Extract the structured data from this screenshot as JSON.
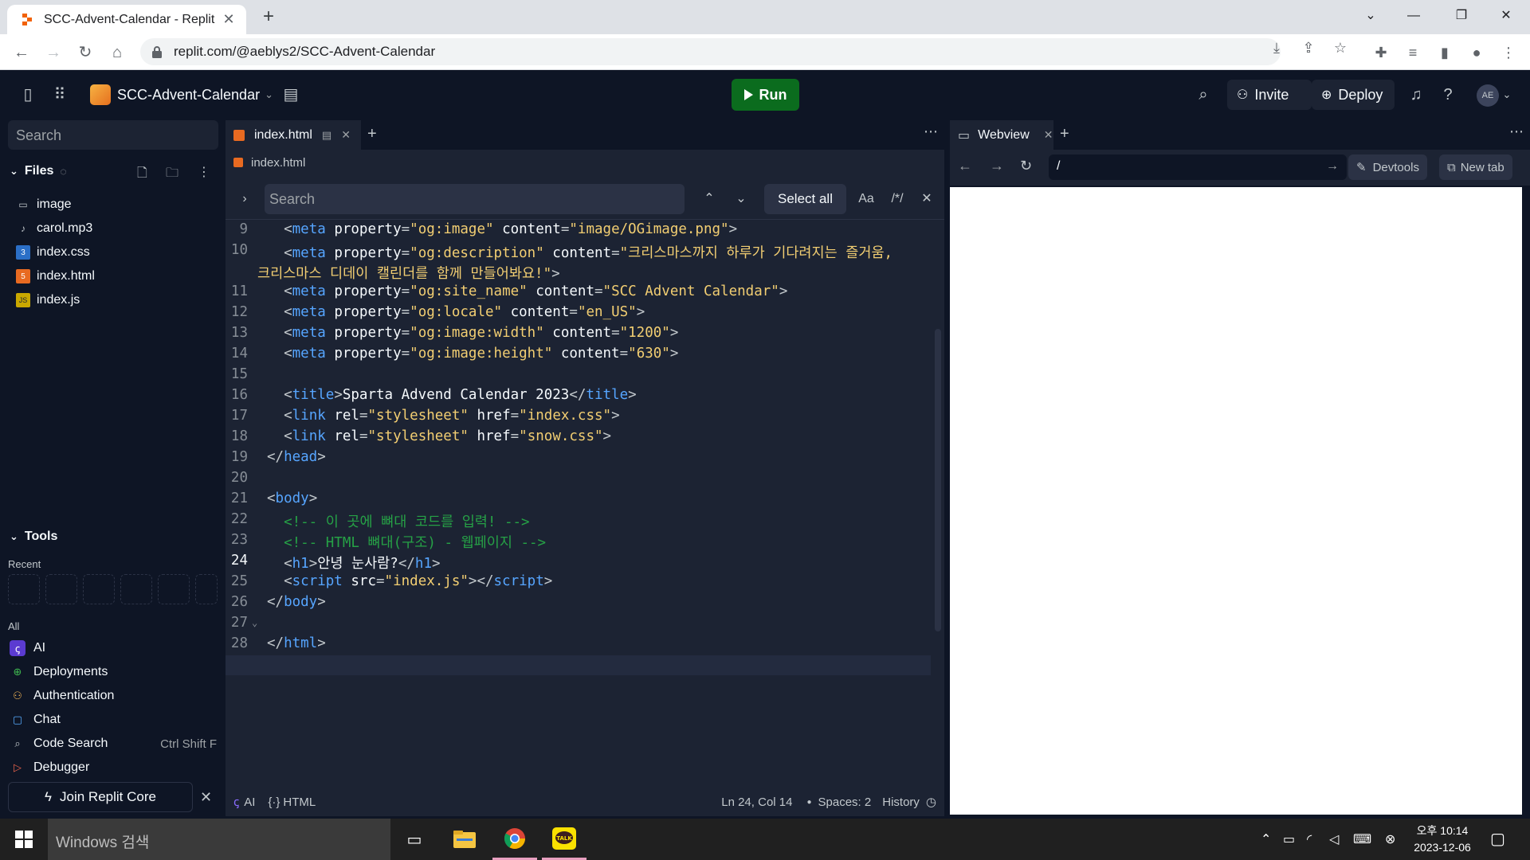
{
  "browser": {
    "tab_title": "SCC-Advent-Calendar - Replit",
    "url": "replit.com/@aeblys2/SCC-Advent-Calendar"
  },
  "header": {
    "project_name": "SCC-Advent-Calendar",
    "run_label": "Run",
    "invite_label": "Invite",
    "deploy_label": "Deploy",
    "avatar_initials": "AE"
  },
  "sidebar": {
    "search_placeholder": "Search",
    "files_label": "Files",
    "files": [
      {
        "name": "image",
        "icon": "folder-icon"
      },
      {
        "name": "carol.mp3",
        "icon": "music-note-icon"
      },
      {
        "name": "index.css",
        "icon": "css-file-icon"
      },
      {
        "name": "index.html",
        "icon": "html-file-icon"
      },
      {
        "name": "index.js",
        "icon": "js-file-icon"
      }
    ],
    "tools_label": "Tools",
    "recent_label": "Recent",
    "all_label": "All",
    "tools": [
      {
        "name": "AI",
        "shortcut": ""
      },
      {
        "name": "Deployments",
        "shortcut": ""
      },
      {
        "name": "Authentication",
        "shortcut": ""
      },
      {
        "name": "Chat",
        "shortcut": ""
      },
      {
        "name": "Code Search",
        "shortcut": "Ctrl Shift F"
      },
      {
        "name": "Debugger",
        "shortcut": ""
      }
    ],
    "join_label": "Join Replit Core"
  },
  "editor": {
    "tab_name": "index.html",
    "breadcrumb": "index.html",
    "find_placeholder": "Search",
    "select_all_label": "Select all",
    "match_case_label": "Aa",
    "regex_label": "/*/",
    "lines": [
      {
        "n": "9",
        "html": "  <span class='p'>&lt;</span><span class='t'>meta</span> <span class='a'>property</span><span class='p'>=</span><span class='s'>\"og:image\"</span> <span class='a'>content</span><span class='p'>=</span><span class='s'>\"image/OGimage.png\"</span><span class='p'>&gt;</span>"
      },
      {
        "n": "10",
        "html": "  <span class='p'>&lt;</span><span class='t'>meta</span> <span class='a'>property</span><span class='p'>=</span><span class='s'>\"og:description\"</span> <span class='a'>content</span><span class='p'>=</span><span class='s'>\"크리스마스까지 하루가 기다려지는 즐거움,</span>"
      },
      {
        "n": "",
        "html": "<span class='s'>크리스마스 디데이 캘린더를 함께 만들어봐요!\"</span><span class='p'>&gt;</span>"
      },
      {
        "n": "11",
        "html": "  <span class='p'>&lt;</span><span class='t'>meta</span> <span class='a'>property</span><span class='p'>=</span><span class='s'>\"og:site_name\"</span> <span class='a'>content</span><span class='p'>=</span><span class='s'>\"SCC Advent Calendar\"</span><span class='p'>&gt;</span>"
      },
      {
        "n": "12",
        "html": "  <span class='p'>&lt;</span><span class='t'>meta</span> <span class='a'>property</span><span class='p'>=</span><span class='s'>\"og:locale\"</span> <span class='a'>content</span><span class='p'>=</span><span class='s'>\"en_US\"</span><span class='p'>&gt;</span>"
      },
      {
        "n": "13",
        "html": "  <span class='p'>&lt;</span><span class='t'>meta</span> <span class='a'>property</span><span class='p'>=</span><span class='s'>\"og:image:width\"</span> <span class='a'>content</span><span class='p'>=</span><span class='s'>\"1200\"</span><span class='p'>&gt;</span>"
      },
      {
        "n": "14",
        "html": "  <span class='p'>&lt;</span><span class='t'>meta</span> <span class='a'>property</span><span class='p'>=</span><span class='s'>\"og:image:height\"</span> <span class='a'>content</span><span class='p'>=</span><span class='s'>\"630\"</span><span class='p'>&gt;</span>"
      },
      {
        "n": "15",
        "html": ""
      },
      {
        "n": "16",
        "html": "  <span class='p'>&lt;</span><span class='t'>title</span><span class='p'>&gt;</span>Sparta Advend Calendar 2023<span class='p'>&lt;/</span><span class='t'>title</span><span class='p'>&gt;</span>"
      },
      {
        "n": "17",
        "html": "  <span class='p'>&lt;</span><span class='t'>link</span> <span class='a'>rel</span><span class='p'>=</span><span class='s'>\"stylesheet\"</span> <span class='a'>href</span><span class='p'>=</span><span class='s'>\"index.css\"</span><span class='p'>&gt;</span>"
      },
      {
        "n": "18",
        "html": "  <span class='p'>&lt;</span><span class='t'>link</span> <span class='a'>rel</span><span class='p'>=</span><span class='s'>\"stylesheet\"</span> <span class='a'>href</span><span class='p'>=</span><span class='s'>\"snow.css\"</span><span class='p'>&gt;</span>"
      },
      {
        "n": "19",
        "html": "<span class='p'>&lt;/</span><span class='t'>head</span><span class='p'>&gt;</span>"
      },
      {
        "n": "20",
        "html": ""
      },
      {
        "n": "21",
        "html": "<span class='p'>&lt;</span><span class='t'>body</span><span class='p'>&gt;</span>"
      },
      {
        "n": "22",
        "html": "  <span class='c'>&lt;!-- 이 곳에 뼈대 코드를 입력! --&gt;</span>"
      },
      {
        "n": "23",
        "html": "  <span class='c'>&lt;!-- HTML 뼈대(구조) - 웹페이지 --&gt;</span>"
      },
      {
        "n": "24",
        "html": "  <span class='p'>&lt;</span><span class='t'>h1</span><span class='p'>&gt;</span>안녕 눈사람?<span class='p'>&lt;/</span><span class='t'>h1</span><span class='p'>&gt;</span>"
      },
      {
        "n": "25",
        "html": "  <span class='p'>&lt;</span><span class='t'>script</span> <span class='a'>src</span><span class='p'>=</span><span class='s'>\"index.js\"</span><span class='p'>&gt;&lt;/</span><span class='t'>script</span><span class='p'>&gt;</span>"
      },
      {
        "n": "26",
        "html": "<span class='p'>&lt;/</span><span class='t'>body</span><span class='p'>&gt;</span>"
      },
      {
        "n": "27",
        "html": ""
      },
      {
        "n": "28",
        "html": "<span class='p'>&lt;/</span><span class='t'>html</span><span class='p'>&gt;</span>"
      }
    ],
    "status": {
      "ai": "AI",
      "lang": "HTML",
      "position": "Ln 24, Col 14",
      "spaces": "Spaces: 2",
      "history": "History"
    }
  },
  "webview": {
    "tab_name": "Webview",
    "url": "/",
    "devtools_label": "Devtools",
    "newtab_label": "New tab"
  },
  "taskbar": {
    "search_placeholder": "Windows 검색",
    "time": "오후 10:14",
    "date": "2023-12-06"
  }
}
